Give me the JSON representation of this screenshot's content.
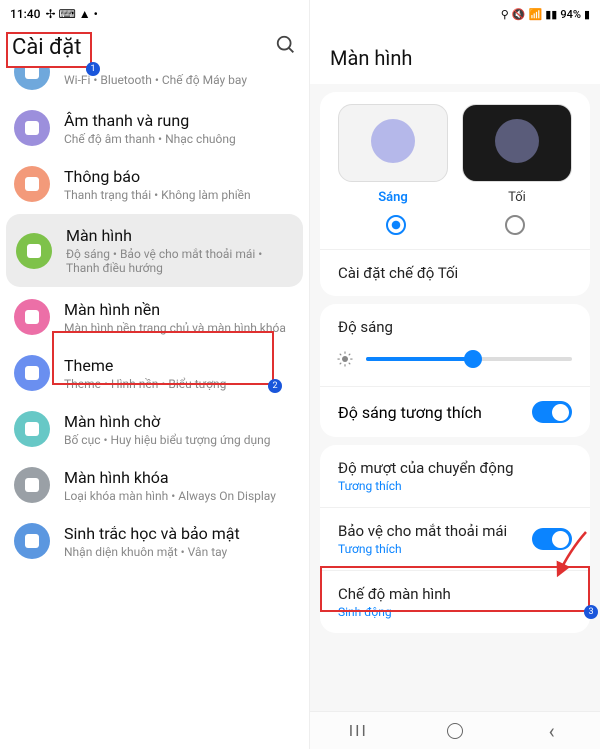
{
  "status": {
    "time": "11:40",
    "battery": "94%"
  },
  "left": {
    "header": "Cài đặt",
    "items": [
      {
        "title": "",
        "subtitle": "Wi-Fi  •  Bluetooth  •  Chế độ Máy bay",
        "iconColor": "#6fa8dc",
        "partial": true
      },
      {
        "title": "Âm thanh và rung",
        "subtitle": "Chế độ âm thanh  •  Nhạc chuông",
        "iconColor": "#9c8fdc"
      },
      {
        "title": "Thông báo",
        "subtitle": "Thanh trạng thái  •  Không làm phiền",
        "iconColor": "#f39a7a"
      },
      {
        "title": "Màn hình",
        "subtitle": "Độ sáng  •  Bảo vệ cho mắt thoải mái  •  Thanh điều hướng",
        "iconColor": "#7ec24a",
        "selected": true
      },
      {
        "title": "Màn hình nền",
        "subtitle": "Màn hình nền trang chủ và màn hình khóa",
        "iconColor": "#ec6fa7"
      },
      {
        "title": "Theme",
        "subtitle": "Theme  •  Hình nền  •  Biểu tượng",
        "iconColor": "#6a8ff0"
      },
      {
        "title": "Màn hình chờ",
        "subtitle": "Bố cục  •  Huy hiệu biểu tượng ứng dụng",
        "iconColor": "#67c8c6"
      },
      {
        "title": "Màn hình khóa",
        "subtitle": "Loại khóa màn hình  •  Always On Display",
        "iconColor": "#9aa0a6"
      },
      {
        "title": "Sinh trắc học và bảo mật",
        "subtitle": "Nhận diện khuôn mặt  •  Vân tay",
        "iconColor": "#5b97e0"
      }
    ]
  },
  "right": {
    "header": "Màn hình",
    "theme": {
      "light": "Sáng",
      "dark": "Tối"
    },
    "darkModeRow": "Cài đặt chế độ Tối",
    "brightness": {
      "label": "Độ sáng",
      "value": 52
    },
    "adaptive": {
      "label": "Độ sáng tương thích"
    },
    "motion": {
      "title": "Độ mượt của chuyển động",
      "sub": "Tương thích"
    },
    "eyeComfort": {
      "title": "Bảo vệ cho mắt thoải mái",
      "sub": "Tương thích"
    },
    "screenMode": {
      "title": "Chế độ màn hình",
      "sub": "Sinh động"
    }
  },
  "nav": {
    "recent": "|||",
    "home": "◯",
    "back": "‹"
  }
}
